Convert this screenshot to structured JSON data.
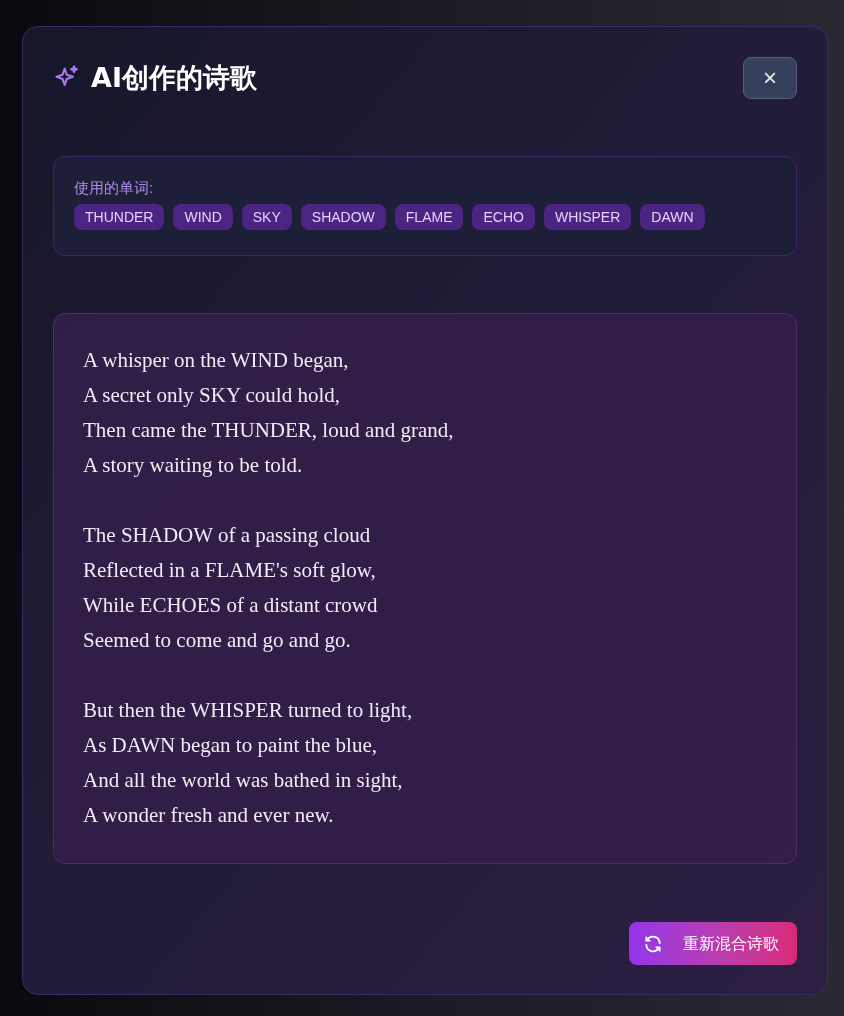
{
  "dialog": {
    "title": "AI创作的诗歌",
    "close": "×"
  },
  "words_panel": {
    "label": "使用的单词:",
    "words": [
      "THUNDER",
      "WIND",
      "SKY",
      "SHADOW",
      "FLAME",
      "ECHO",
      "WHISPER",
      "DAWN"
    ]
  },
  "poem": {
    "stanzas": [
      [
        "A whisper on the WIND began,",
        "A secret only SKY could hold,",
        "Then came the THUNDER, loud and grand,",
        "A story waiting to be told."
      ],
      [
        "The SHADOW of a passing cloud",
        "Reflected in a FLAME's soft glow,",
        "While ECHOES of a distant crowd",
        "Seemed to come and go and go."
      ],
      [
        "But then the WHISPER turned to light,",
        "As DAWN began to paint the blue,",
        "And all the world was bathed in sight,",
        "A wonder fresh and ever new."
      ]
    ]
  },
  "remix_button": {
    "label": "重新混合诗歌"
  }
}
